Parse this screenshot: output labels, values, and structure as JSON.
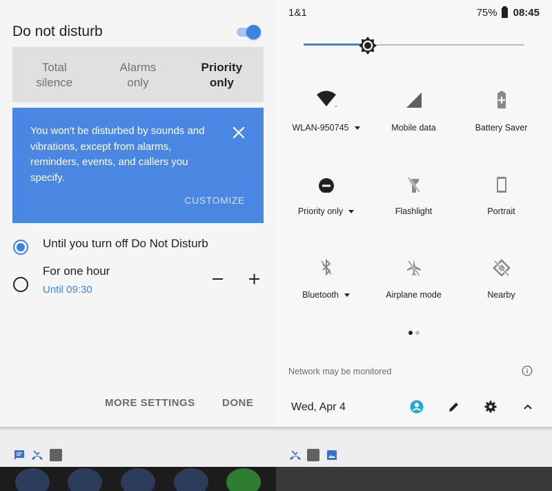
{
  "dnd": {
    "title": "Do not disturb",
    "toggle_on": true,
    "modes": [
      {
        "line1": "Total",
        "line2": "silence",
        "active": false
      },
      {
        "line1": "Alarms",
        "line2": "only",
        "active": false
      },
      {
        "line1": "Priority",
        "line2": "only",
        "active": true
      }
    ],
    "info_text": "You won't be disturbed by sounds and vibrations, except from alarms, reminders, events, and callers you specify.",
    "customize_label": "CUSTOMIZE",
    "options": {
      "until_label": "Until you turn off Do Not Disturb",
      "hour_label": "For one hour",
      "hour_sub": "Until 09:30"
    },
    "more_settings_label": "MORE SETTINGS",
    "done_label": "DONE"
  },
  "status_bar": {
    "carrier": "1&1",
    "battery_percent": "75%",
    "time": "08:45"
  },
  "brightness": {
    "level_percent": 29
  },
  "tiles": [
    {
      "label": "WLAN-950745",
      "icon": "wifi-icon",
      "dropdown": true
    },
    {
      "label": "Mobile data",
      "icon": "signal-icon",
      "dropdown": false
    },
    {
      "label": "Battery Saver",
      "icon": "battery-saver-icon",
      "dropdown": false
    },
    {
      "label": "Priority only",
      "icon": "dnd-icon",
      "dropdown": true
    },
    {
      "label": "Flashlight",
      "icon": "flashlight-icon",
      "dropdown": false
    },
    {
      "label": "Portrait",
      "icon": "portrait-icon",
      "dropdown": false
    },
    {
      "label": "Bluetooth",
      "icon": "bluetooth-icon",
      "dropdown": true
    },
    {
      "label": "Airplane mode",
      "icon": "airplane-icon",
      "dropdown": false
    },
    {
      "label": "Nearby",
      "icon": "nearby-icon",
      "dropdown": false
    }
  ],
  "footer": {
    "network_msg": "Network may be monitored",
    "date": "Wed, Apr 4"
  },
  "colors": {
    "accent": "#3b82e7",
    "card": "#4a87e3",
    "user_icon": "#23a8d8"
  }
}
